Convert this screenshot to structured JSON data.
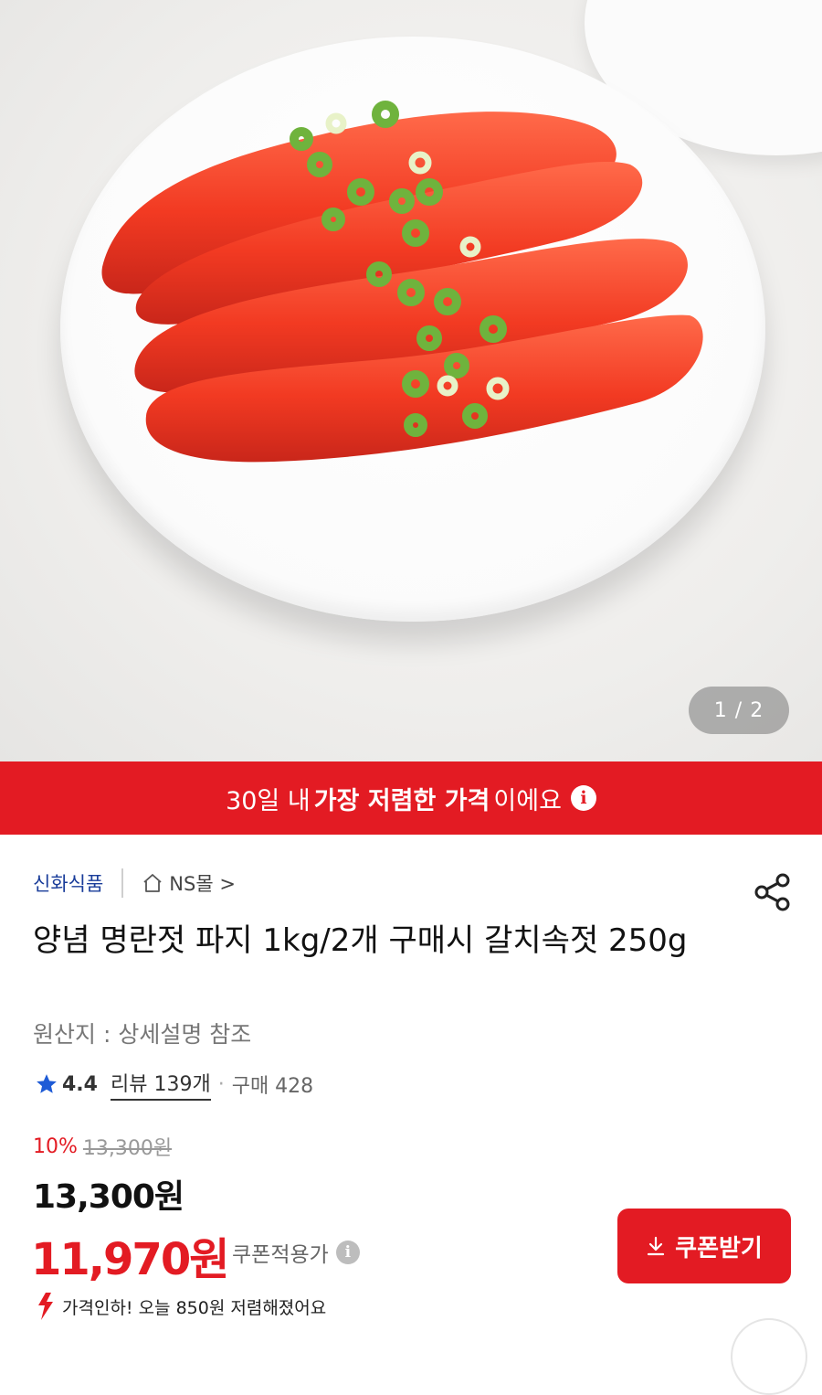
{
  "gallery": {
    "counter": "1 / 2"
  },
  "banner": {
    "pre": "30일 내 ",
    "bold": "가장 저렴한 가격",
    "post": "이에요",
    "icon": "info-icon"
  },
  "product": {
    "brand": "신화식품",
    "mall": "NS몰 >",
    "title": "양념 명란젓 파지 1kg/2개 구매시 갈치속젓 250g",
    "origin": "원산지 : 상세설명 참조",
    "rating": "4.4",
    "review": "리뷰 139개",
    "separator": "·",
    "purchase": "구매 428"
  },
  "price": {
    "discount_pct": "10%",
    "original": "13,300원",
    "sale": "13,300원",
    "coupon_price": "11,970원",
    "coupon_label": "쿠폰적용가",
    "coupon_button": "쿠폰받기",
    "drop_notice": "가격인하! 오늘 850원 저렴해졌어요"
  },
  "colors": {
    "accent": "#e31b23",
    "brand_link": "#1a3d9a",
    "star": "#1e5bd6"
  }
}
